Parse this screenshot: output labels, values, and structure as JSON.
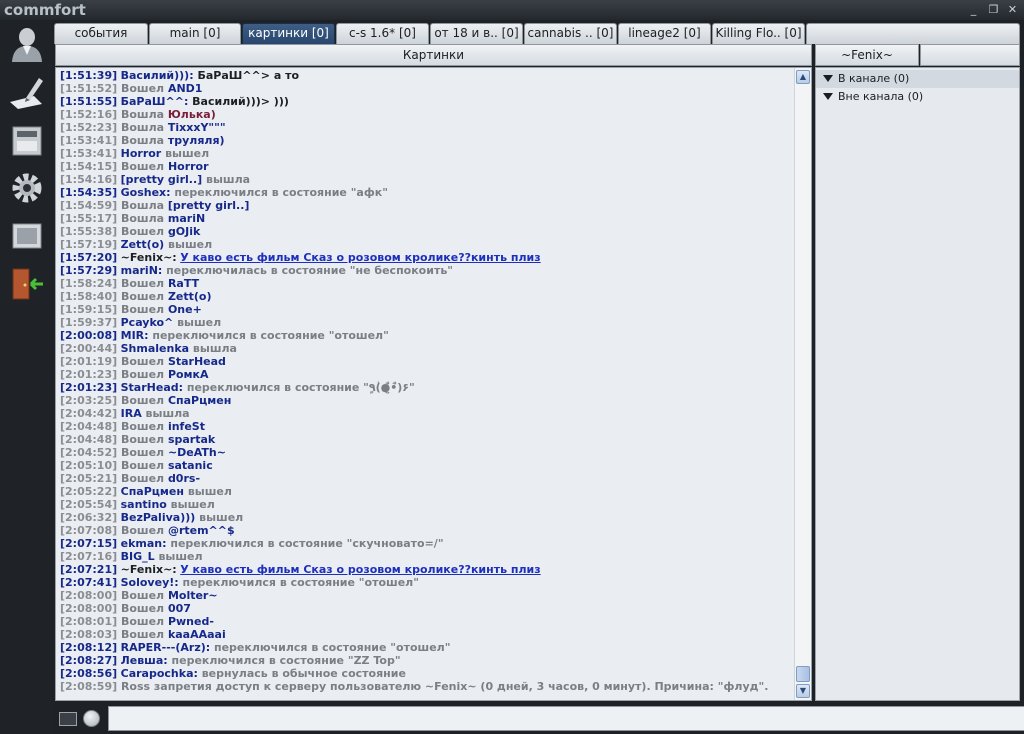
{
  "app": {
    "logo_text": "commfort",
    "window_buttons": {
      "minimize": "_",
      "maximize": "❐",
      "close": "✕"
    }
  },
  "sidebar": {
    "icons": [
      "user-icon",
      "pen-icon",
      "drive-icon",
      "settings-gear-icon",
      "image-icon",
      "exit-door-icon"
    ]
  },
  "tabs": [
    {
      "label": "события",
      "active": false
    },
    {
      "label": "main [0]",
      "active": false
    },
    {
      "label": "картинки [0]",
      "active": true
    },
    {
      "label": "c-s 1.6* [0]",
      "active": false
    },
    {
      "label": "от 18 и в.. [0]",
      "active": false
    },
    {
      "label": "cannabis .. [0]",
      "active": false
    },
    {
      "label": "lineage2 [0]",
      "active": false
    },
    {
      "label": "Killing Flo.. [0]",
      "active": false
    }
  ],
  "chat": {
    "title": "Картинки",
    "lines": [
      {
        "t": "[1:51:39]",
        "kind": "msg",
        "nick": "Василий))):",
        "text": " БаРаШ^^> а то"
      },
      {
        "t": "[1:51:52]",
        "kind": "ev",
        "ev": " Вошел ",
        "nick": "AND1",
        "text": ""
      },
      {
        "t": "[1:51:55]",
        "kind": "msg",
        "nick": "БаРаШ^^:",
        "text": " Василий)))> )))"
      },
      {
        "t": "[1:52:16]",
        "kind": "evred",
        "ev": " Вошла ",
        "nick": "Юлька)",
        "text": ""
      },
      {
        "t": "[1:52:23]",
        "kind": "ev",
        "ev": " Вошла ",
        "nick": "TixxxY\"\"\"",
        "text": ""
      },
      {
        "t": "[1:53:41]",
        "kind": "ev",
        "ev": " Вошла ",
        "nick": "труляля)",
        "text": ""
      },
      {
        "t": "[1:53:41]",
        "kind": "evpost",
        "nick": "Horror",
        "ev": " вышел",
        "text": ""
      },
      {
        "t": "[1:54:15]",
        "kind": "ev",
        "ev": " Вошел ",
        "nick": "Horror",
        "text": ""
      },
      {
        "t": "[1:54:16]",
        "kind": "evpost",
        "nick": "[pretty girl..]",
        "ev": " вышла",
        "text": ""
      },
      {
        "t": "[1:54:35]",
        "kind": "state",
        "nick": "Goshex:",
        "text": " переключился в состояние \"афк\""
      },
      {
        "t": "[1:54:59]",
        "kind": "ev",
        "ev": " Вошла ",
        "nick": "[pretty girl..]",
        "text": ""
      },
      {
        "t": "[1:55:17]",
        "kind": "ev",
        "ev": " Вошла ",
        "nick": "mariN",
        "text": ""
      },
      {
        "t": "[1:55:38]",
        "kind": "ev",
        "ev": " Вошел ",
        "nick": "gOJik",
        "text": ""
      },
      {
        "t": "[1:57:19]",
        "kind": "evpost",
        "nick": "Zett(o)",
        "ev": " вышел",
        "text": ""
      },
      {
        "t": "[1:57:20]",
        "kind": "link",
        "nick": "~Fenix~:",
        "text": "У каво есть фильм Сказ о розовом кролике??кинть плиз"
      },
      {
        "t": "[1:57:29]",
        "kind": "state",
        "nick": "mariN:",
        "text": " переключилась в состояние \"не беспокоить\""
      },
      {
        "t": "[1:58:24]",
        "kind": "ev",
        "ev": " Вошел ",
        "nick": "RaTT",
        "text": ""
      },
      {
        "t": "[1:58:40]",
        "kind": "ev",
        "ev": " Вошел ",
        "nick": "Zett(o)",
        "text": ""
      },
      {
        "t": "[1:59:15]",
        "kind": "ev",
        "ev": " Вошел ",
        "nick": "One+",
        "text": ""
      },
      {
        "t": "[1:59:37]",
        "kind": "evpost",
        "nick": "Pcayko^",
        "ev": " вышел",
        "text": ""
      },
      {
        "t": "[2:00:08]",
        "kind": "state",
        "nick": "MIR:",
        "text": " переключился в состояние \"отошел\""
      },
      {
        "t": "[2:00:44]",
        "kind": "evpost",
        "nick": "Shmalenka",
        "ev": " вышла",
        "text": ""
      },
      {
        "t": "[2:01:19]",
        "kind": "ev",
        "ev": " Вошел ",
        "nick": "StarHead",
        "text": ""
      },
      {
        "t": "[2:01:23]",
        "kind": "ev",
        "ev": " Вошел ",
        "nick": "РомкА",
        "text": ""
      },
      {
        "t": "[2:01:23]",
        "kind": "state",
        "nick": "StarHead:",
        "text": " переключился в состояние \"ٍ٩(̾●̮̮̃̾•̃̾)۶\""
      },
      {
        "t": "[2:03:25]",
        "kind": "ev",
        "ev": " Вошел ",
        "nick": "СпаРцмен",
        "text": ""
      },
      {
        "t": "[2:04:42]",
        "kind": "evpost",
        "nick": "IRA",
        "ev": " вышла",
        "text": ""
      },
      {
        "t": "[2:04:48]",
        "kind": "ev",
        "ev": " Вошел ",
        "nick": "infeSt",
        "text": ""
      },
      {
        "t": "[2:04:48]",
        "kind": "ev",
        "ev": " Вошел ",
        "nick": "spartak",
        "text": ""
      },
      {
        "t": "[2:04:52]",
        "kind": "ev",
        "ev": " Вошел ",
        "nick": "~DeATh~",
        "text": ""
      },
      {
        "t": "[2:05:10]",
        "kind": "ev",
        "ev": " Вошел ",
        "nick": "satanic",
        "text": ""
      },
      {
        "t": "[2:05:21]",
        "kind": "ev",
        "ev": " Вошел ",
        "nick": "d0rs-",
        "text": ""
      },
      {
        "t": "[2:05:22]",
        "kind": "evpost",
        "nick": "СпаРцмен",
        "ev": " вышел",
        "text": ""
      },
      {
        "t": "[2:05:54]",
        "kind": "evpost",
        "nick": "santino",
        "ev": " вышел",
        "text": ""
      },
      {
        "t": "[2:06:32]",
        "kind": "evpost",
        "nick": "BezPaliva)))",
        "ev": " вышел",
        "text": ""
      },
      {
        "t": "[2:07:08]",
        "kind": "ev",
        "ev": " Вошел ",
        "nick": "@rtem^^$",
        "text": ""
      },
      {
        "t": "[2:07:15]",
        "kind": "state",
        "nick": "ekman:",
        "text": " переключился в состояние \"скучновато=/\""
      },
      {
        "t": "[2:07:16]",
        "kind": "evpost",
        "nick": "BIG_L",
        "ev": " вышел",
        "text": ""
      },
      {
        "t": "[2:07:21]",
        "kind": "link",
        "nick": "~Fenix~:",
        "text": "У каво есть фильм Сказ о розовом кролике??кинть плиз"
      },
      {
        "t": "[2:07:41]",
        "kind": "state",
        "nick": "Solovey!:",
        "text": " переключился в состояние \"отошел\""
      },
      {
        "t": "[2:08:00]",
        "kind": "ev",
        "ev": " Вошел ",
        "nick": "Molter~",
        "text": ""
      },
      {
        "t": "[2:08:00]",
        "kind": "ev",
        "ev": " Вошел ",
        "nick": "007",
        "text": ""
      },
      {
        "t": "[2:08:01]",
        "kind": "ev",
        "ev": " Вошел ",
        "nick": "Pwned-",
        "text": ""
      },
      {
        "t": "[2:08:03]",
        "kind": "ev",
        "ev": " Вошел ",
        "nick": "kaaAAaai",
        "text": ""
      },
      {
        "t": "[2:08:12]",
        "kind": "state",
        "nick": "RAPER---(Arz):",
        "text": " переключился в состояние \"отошел\""
      },
      {
        "t": "[2:08:27]",
        "kind": "state",
        "nick": "Левша:",
        "text": " переключился в состояние \"ZZ Top\""
      },
      {
        "t": "[2:08:56]",
        "kind": "state",
        "nick": "Carapochka:",
        "text": " вернулась в обычное состояние"
      },
      {
        "t": "[2:08:59]",
        "kind": "sys",
        "text": " Ross запретия доступ к серверу пользователю ~Fenix~ (0 дней, 3 часов, 0 минут). Причина: \"флуд\"."
      }
    ]
  },
  "users": {
    "header": "~Fenix~",
    "groups": [
      {
        "label": "В канале (0)",
        "selected": true
      },
      {
        "label": "Вне канала (0)",
        "selected": false
      }
    ]
  },
  "input": {
    "value": "",
    "placeholder": ""
  }
}
